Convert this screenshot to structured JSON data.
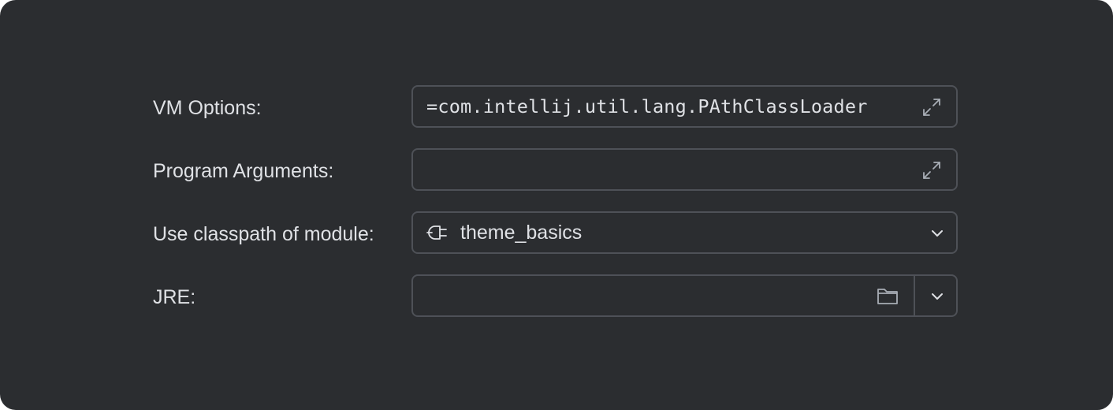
{
  "form": {
    "vm_options": {
      "label": "VM Options:",
      "value": "=com.intellij.util.lang.PAthClassLoader",
      "icon": "expand-icon"
    },
    "program_arguments": {
      "label": "Program Arguments:",
      "value": "",
      "icon": "expand-icon"
    },
    "classpath_module": {
      "label": "Use classpath of module:",
      "value": "theme_basics",
      "icon": "module-plug-icon",
      "dropdown_icon": "chevron-down-icon"
    },
    "jre": {
      "label": "JRE:",
      "value": "",
      "browse_icon": "folder-icon",
      "dropdown_icon": "chevron-down-icon"
    }
  },
  "colors": {
    "background": "#2b2d30",
    "text": "#dfe1e5",
    "border": "#4e5157",
    "icon": "#a8adb5"
  }
}
